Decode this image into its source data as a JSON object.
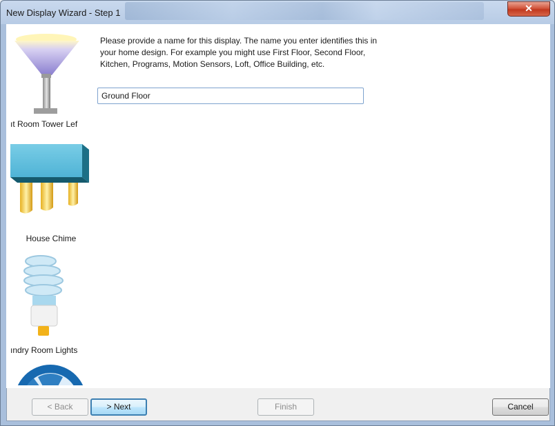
{
  "window": {
    "title": "New Display Wizard - Step 1",
    "close_glyph": "✕"
  },
  "sidebar": {
    "items": [
      {
        "label": "ıt Room Tower Lef",
        "icon": "torch-lamp-icon"
      },
      {
        "label": "House Chime",
        "icon": "house-chime-icon"
      },
      {
        "label": "ındry Room Lights",
        "icon": "cfl-bulb-icon"
      },
      {
        "label": "",
        "icon": "fan-icon"
      }
    ]
  },
  "main": {
    "description": "Please provide a name for this display.  The name you enter identifies this in your home design.  For example you might use First Floor, Second Floor, Kitchen, Programs, Motion Sensors, Loft, Office Building, etc.",
    "name_value": "Ground Floor"
  },
  "buttons": {
    "back": "< Back",
    "next": "> Next",
    "finish": "Finish",
    "cancel": "Cancel"
  },
  "colors": {
    "title_bg": "#b7cbe5",
    "close": "#c1391f",
    "accent": "#3c7fb1"
  }
}
